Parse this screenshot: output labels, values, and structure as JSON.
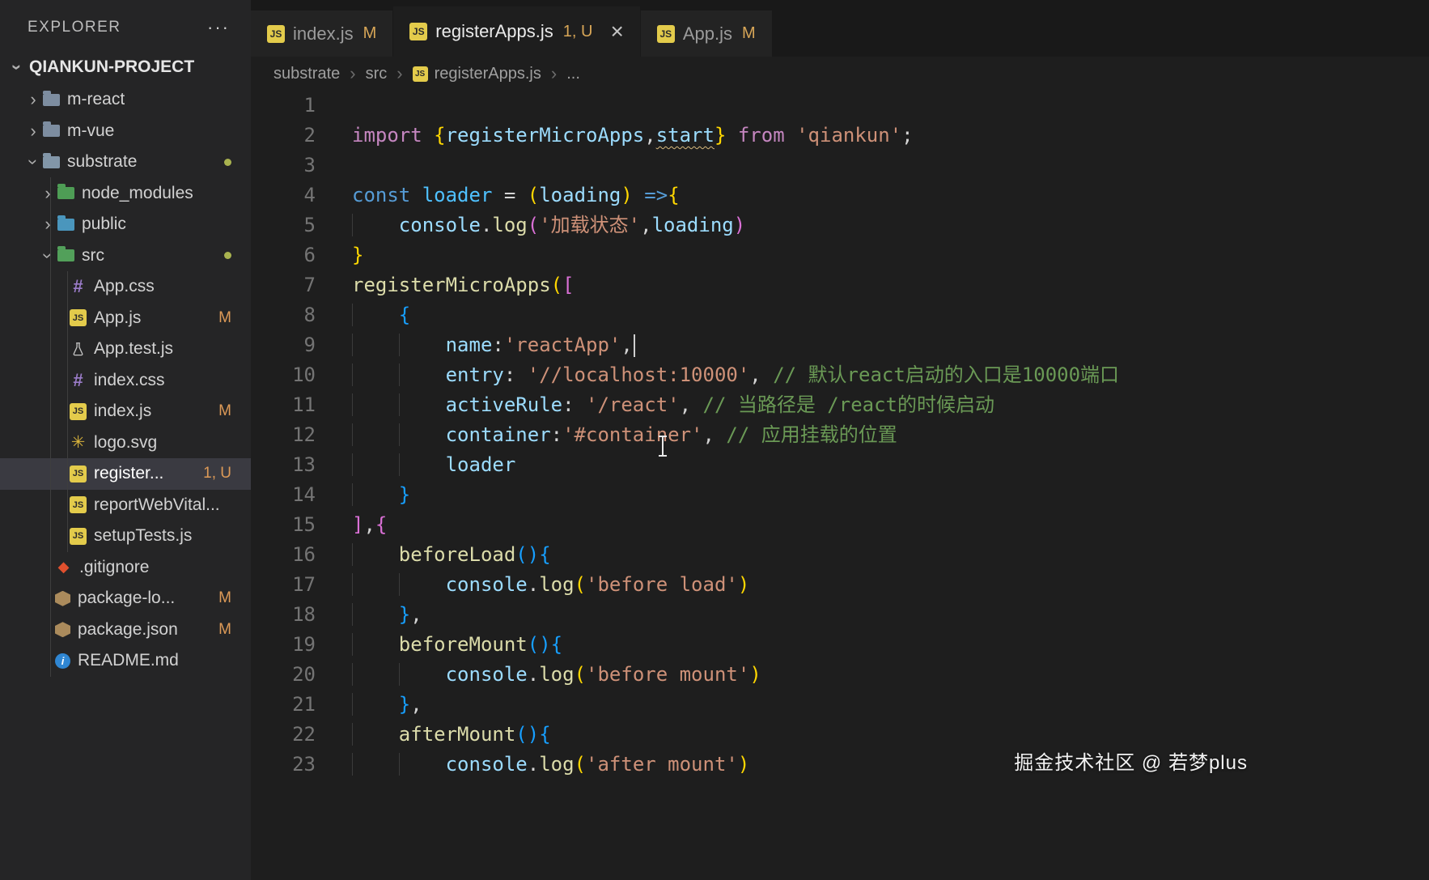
{
  "explorer": {
    "title": "EXPLORER",
    "more_label": "···",
    "project": "QIANKUN-PROJECT",
    "tree": [
      {
        "label": "m-react",
        "kind": "folder",
        "depth": 1,
        "chevron": "right",
        "icon": "folder",
        "color": "#7d8da0"
      },
      {
        "label": "m-vue",
        "kind": "folder",
        "depth": 1,
        "chevron": "right",
        "icon": "folder",
        "color": "#7d8da0"
      },
      {
        "label": "substrate",
        "kind": "folder",
        "depth": 1,
        "chevron": "down",
        "icon": "folder",
        "color": "#8296a8",
        "dot": true
      },
      {
        "label": "node_modules",
        "kind": "folder",
        "depth": 2,
        "chevron": "right",
        "icon": "folder",
        "color": "#4e9d55"
      },
      {
        "label": "public",
        "kind": "folder",
        "depth": 2,
        "chevron": "right",
        "icon": "folder",
        "color": "#4a96bd"
      },
      {
        "label": "src",
        "kind": "folder",
        "depth": 2,
        "chevron": "down",
        "icon": "folder",
        "color": "#52a05a",
        "dot": true
      },
      {
        "label": "App.css",
        "kind": "file",
        "depth": 3,
        "icon": "css"
      },
      {
        "label": "App.js",
        "kind": "file",
        "depth": 3,
        "icon": "js",
        "badge": "M"
      },
      {
        "label": "App.test.js",
        "kind": "file",
        "depth": 3,
        "icon": "flask"
      },
      {
        "label": "index.css",
        "kind": "file",
        "depth": 3,
        "icon": "css"
      },
      {
        "label": "index.js",
        "kind": "file",
        "depth": 3,
        "icon": "js",
        "badge": "M"
      },
      {
        "label": "logo.svg",
        "kind": "file",
        "depth": 3,
        "icon": "svg"
      },
      {
        "label": "register...",
        "kind": "file",
        "depth": 3,
        "icon": "js",
        "badge": "1, U",
        "selected": true
      },
      {
        "label": "reportWebVital...",
        "kind": "file",
        "depth": 3,
        "icon": "js"
      },
      {
        "label": "setupTests.js",
        "kind": "file",
        "depth": 3,
        "icon": "js"
      },
      {
        "label": ".gitignore",
        "kind": "file",
        "depth": 2,
        "icon": "git"
      },
      {
        "label": "package-lo...",
        "kind": "file",
        "depth": 2,
        "icon": "npm",
        "badge": "M"
      },
      {
        "label": "package.json",
        "kind": "file",
        "depth": 2,
        "icon": "npm",
        "badge": "M"
      },
      {
        "label": "README.md",
        "kind": "file",
        "depth": 2,
        "icon": "info"
      }
    ]
  },
  "tabs": [
    {
      "label": "index.js",
      "badge": "M",
      "active": false
    },
    {
      "label": "registerApps.js",
      "badge": "1, U",
      "active": true,
      "close": "×"
    },
    {
      "label": "App.js",
      "badge": "M",
      "active": false
    }
  ],
  "breadcrumb": {
    "separator": "›",
    "items": [
      {
        "label": "substrate"
      },
      {
        "label": "src"
      },
      {
        "label": "registerApps.js",
        "icon": "js"
      },
      {
        "label": "..."
      }
    ]
  },
  "editor": {
    "lines": [
      {
        "num": "1",
        "tokens": []
      },
      {
        "num": "2",
        "tokens": [
          [
            "kw1",
            "import"
          ],
          [
            "pun",
            " "
          ],
          [
            "b1",
            "{"
          ],
          [
            "vr",
            "registerMicroApps"
          ],
          [
            "pun",
            ","
          ],
          [
            "vr warn",
            "start"
          ],
          [
            "b1",
            "}"
          ],
          [
            "pun",
            " "
          ],
          [
            "kw1",
            "from"
          ],
          [
            "pun",
            " "
          ],
          [
            "str",
            "'qiankun'"
          ],
          [
            "pun",
            ";"
          ]
        ]
      },
      {
        "num": "3",
        "tokens": []
      },
      {
        "num": "4",
        "tokens": [
          [
            "kw2",
            "const"
          ],
          [
            "pun",
            " "
          ],
          [
            "decl",
            "loader"
          ],
          [
            "pun",
            " = "
          ],
          [
            "b1",
            "("
          ],
          [
            "vr",
            "loading"
          ],
          [
            "b1",
            ")"
          ],
          [
            "pun",
            " "
          ],
          [
            "kw2",
            "=>"
          ],
          [
            "b1",
            "{"
          ]
        ]
      },
      {
        "num": "5",
        "tokens": [
          [
            "ind",
            "    "
          ],
          [
            "vr",
            "console"
          ],
          [
            "pun",
            "."
          ],
          [
            "fn",
            "log"
          ],
          [
            "b2",
            "("
          ],
          [
            "str",
            "'加载状态'"
          ],
          [
            "pun",
            ","
          ],
          [
            "vr",
            "loading"
          ],
          [
            "b2",
            ")"
          ]
        ]
      },
      {
        "num": "6",
        "tokens": [
          [
            "b1",
            "}"
          ]
        ]
      },
      {
        "num": "7",
        "tokens": [
          [
            "fn",
            "registerMicroApps"
          ],
          [
            "b1",
            "("
          ],
          [
            "b2",
            "["
          ]
        ]
      },
      {
        "num": "8",
        "tokens": [
          [
            "ind",
            "    "
          ],
          [
            "b3",
            "{"
          ]
        ]
      },
      {
        "num": "9",
        "tokens": [
          [
            "ind",
            "    "
          ],
          [
            "ind",
            "    "
          ],
          [
            "vr",
            "name"
          ],
          [
            "pun",
            ":"
          ],
          [
            "str",
            "'reactApp'"
          ],
          [
            "pun",
            ","
          ],
          [
            "cursor",
            ""
          ]
        ]
      },
      {
        "num": "10",
        "tokens": [
          [
            "ind",
            "    "
          ],
          [
            "ind",
            "    "
          ],
          [
            "vr",
            "entry"
          ],
          [
            "pun",
            ": "
          ],
          [
            "str",
            "'//localhost:10000'"
          ],
          [
            "pun",
            ", "
          ],
          [
            "cmt",
            "// 默认react启动的入口是10000端口"
          ]
        ]
      },
      {
        "num": "11",
        "tokens": [
          [
            "ind",
            "    "
          ],
          [
            "ind",
            "    "
          ],
          [
            "vr",
            "activeRule"
          ],
          [
            "pun",
            ": "
          ],
          [
            "str",
            "'/react'"
          ],
          [
            "pun",
            ", "
          ],
          [
            "cmt",
            "// 当路径是 /react的时候启动"
          ]
        ]
      },
      {
        "num": "12",
        "tokens": [
          [
            "ind",
            "    "
          ],
          [
            "ind",
            "    "
          ],
          [
            "vr",
            "container"
          ],
          [
            "pun",
            ":"
          ],
          [
            "str",
            "'#container'"
          ],
          [
            "pun",
            ", "
          ],
          [
            "cmt",
            "// 应用挂载的位置"
          ]
        ]
      },
      {
        "num": "13",
        "tokens": [
          [
            "ind",
            "    "
          ],
          [
            "ind",
            "    "
          ],
          [
            "vr",
            "loader"
          ]
        ]
      },
      {
        "num": "14",
        "tokens": [
          [
            "ind",
            "    "
          ],
          [
            "b3",
            "}"
          ]
        ]
      },
      {
        "num": "15",
        "tokens": [
          [
            "b2",
            "]"
          ],
          [
            "pun",
            ","
          ],
          [
            "b2",
            "{"
          ]
        ]
      },
      {
        "num": "16",
        "tokens": [
          [
            "ind",
            "    "
          ],
          [
            "fn",
            "beforeLoad"
          ],
          [
            "b3",
            "("
          ],
          [
            "b3",
            ")"
          ],
          [
            "b3",
            "{"
          ]
        ]
      },
      {
        "num": "17",
        "tokens": [
          [
            "ind",
            "    "
          ],
          [
            "ind",
            "    "
          ],
          [
            "vr",
            "console"
          ],
          [
            "pun",
            "."
          ],
          [
            "fn",
            "log"
          ],
          [
            "b1",
            "("
          ],
          [
            "str",
            "'before load'"
          ],
          [
            "b1",
            ")"
          ]
        ]
      },
      {
        "num": "18",
        "tokens": [
          [
            "ind",
            "    "
          ],
          [
            "b3",
            "}"
          ],
          [
            "pun",
            ","
          ]
        ]
      },
      {
        "num": "19",
        "tokens": [
          [
            "ind",
            "    "
          ],
          [
            "fn",
            "beforeMount"
          ],
          [
            "b3",
            "("
          ],
          [
            "b3",
            ")"
          ],
          [
            "b3",
            "{"
          ]
        ]
      },
      {
        "num": "20",
        "tokens": [
          [
            "ind",
            "    "
          ],
          [
            "ind",
            "    "
          ],
          [
            "vr",
            "console"
          ],
          [
            "pun",
            "."
          ],
          [
            "fn",
            "log"
          ],
          [
            "b1",
            "("
          ],
          [
            "str",
            "'before mount'"
          ],
          [
            "b1",
            ")"
          ]
        ]
      },
      {
        "num": "21",
        "tokens": [
          [
            "ind",
            "    "
          ],
          [
            "b3",
            "}"
          ],
          [
            "pun",
            ","
          ]
        ]
      },
      {
        "num": "22",
        "tokens": [
          [
            "ind",
            "    "
          ],
          [
            "fn",
            "afterMount"
          ],
          [
            "b3",
            "("
          ],
          [
            "b3",
            ")"
          ],
          [
            "b3",
            "{"
          ]
        ]
      },
      {
        "num": "23",
        "tokens": [
          [
            "ind",
            "    "
          ],
          [
            "ind",
            "    "
          ],
          [
            "vr",
            "console"
          ],
          [
            "pun",
            "."
          ],
          [
            "fn",
            "log"
          ],
          [
            "b1",
            "("
          ],
          [
            "str",
            "'after mount'"
          ],
          [
            "b1",
            ")"
          ]
        ]
      }
    ]
  },
  "watermark": "掘金技术社区 @ 若梦plus",
  "colors": {
    "sidebar_bg": "#252526",
    "editor_bg": "#1e1e1e",
    "selected_row": "#3a3a41",
    "git_modified_badge": "#dd9a57",
    "modified_dot": "#a9b34f",
    "string": "#ce9178",
    "comment": "#6a9955",
    "keyword": "#c586c0",
    "function": "#dcdcaa",
    "variable": "#9cdcfe"
  }
}
